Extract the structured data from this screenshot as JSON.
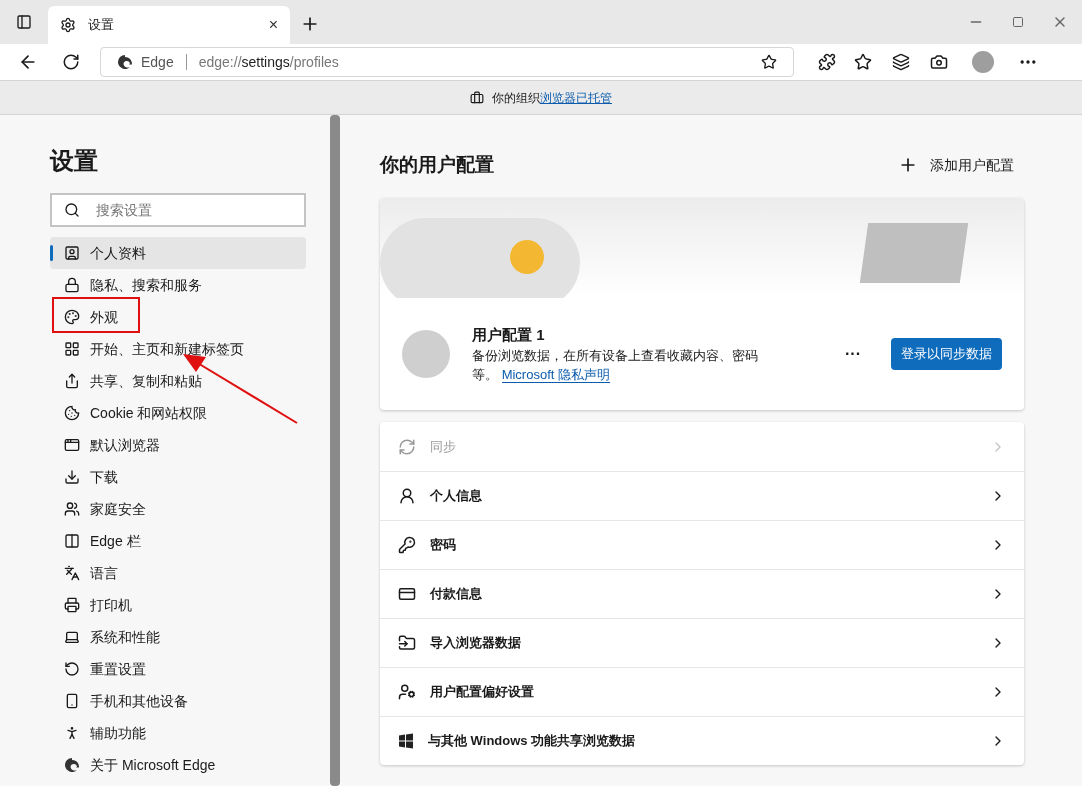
{
  "tab": {
    "title": "设置",
    "close": "×"
  },
  "address": {
    "site": "Edge",
    "url_prefix": "edge://",
    "url_main": "settings",
    "url_suffix": "/profiles"
  },
  "info_bar": {
    "text": "你的组织",
    "link": "浏览器已托管"
  },
  "sidebar": {
    "title": "设置",
    "search": {
      "placeholder": "搜索设置"
    },
    "items": [
      {
        "label": "个人资料",
        "selected": true,
        "annotated": false
      },
      {
        "label": "隐私、搜索和服务",
        "selected": false,
        "annotated": false
      },
      {
        "label": "外观",
        "selected": false,
        "annotated": true
      },
      {
        "label": "开始、主页和新建标签页",
        "selected": false,
        "annotated": false
      },
      {
        "label": "共享、复制和粘贴",
        "selected": false,
        "annotated": false
      },
      {
        "label": "Cookie 和网站权限",
        "selected": false,
        "annotated": false
      },
      {
        "label": "默认浏览器",
        "selected": false,
        "annotated": false
      },
      {
        "label": "下载",
        "selected": false,
        "annotated": false
      },
      {
        "label": "家庭安全",
        "selected": false,
        "annotated": false
      },
      {
        "label": "Edge 栏",
        "selected": false,
        "annotated": false
      },
      {
        "label": "语言",
        "selected": false,
        "annotated": false
      },
      {
        "label": "打印机",
        "selected": false,
        "annotated": false
      },
      {
        "label": "系统和性能",
        "selected": false,
        "annotated": false
      },
      {
        "label": "重置设置",
        "selected": false,
        "annotated": false
      },
      {
        "label": "手机和其他设备",
        "selected": false,
        "annotated": false
      },
      {
        "label": "辅助功能",
        "selected": false,
        "annotated": false
      },
      {
        "label": "关于 Microsoft Edge",
        "selected": false,
        "annotated": false
      }
    ]
  },
  "main": {
    "title": "你的用户配置",
    "add_button": "添加用户配置",
    "profile": {
      "name": "用户配置 1",
      "description": "备份浏览数据，在所有设备上查看收藏内容、密码等。",
      "privacy_link": "Microsoft 隐私声明",
      "more": "···",
      "sign_in_button": "登录以同步数据"
    },
    "rows": [
      {
        "label": "同步",
        "disabled": true
      },
      {
        "label": "个人信息",
        "disabled": false
      },
      {
        "label": "密码",
        "disabled": false
      },
      {
        "label": "付款信息",
        "disabled": false
      },
      {
        "label": "导入浏览器数据",
        "disabled": false
      },
      {
        "label": "用户配置偏好设置",
        "disabled": false
      },
      {
        "label": "与其他 Windows 功能共享浏览数据",
        "disabled": false
      }
    ]
  }
}
